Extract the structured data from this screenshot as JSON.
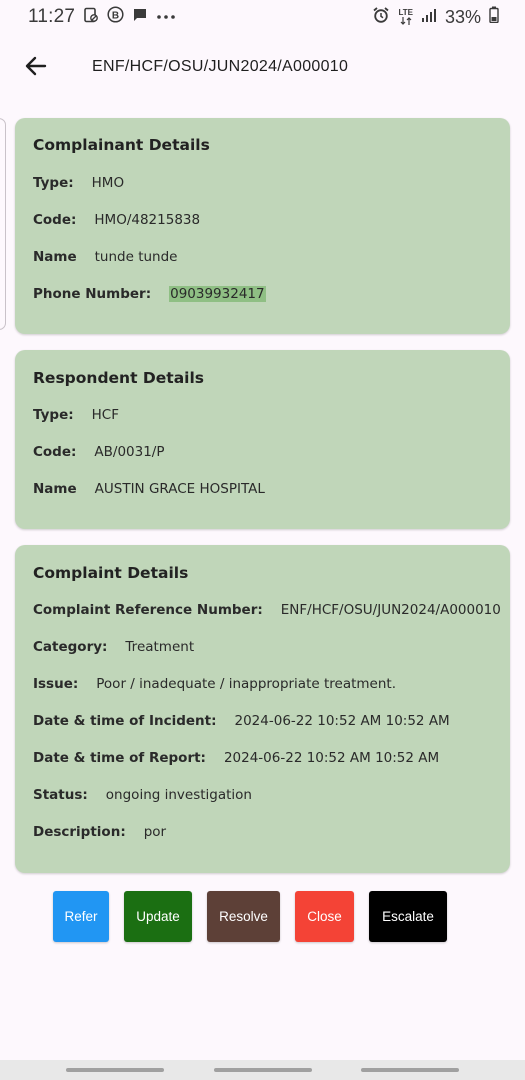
{
  "status_bar": {
    "time": "11:27",
    "left_icons": [
      "silent-phone-icon",
      "b-badge-icon",
      "message-icon",
      "more-dots-icon"
    ],
    "right_icons": [
      "alarm-icon",
      "lte-icon",
      "signal-icon"
    ],
    "network_label": "LTE",
    "battery": "33%"
  },
  "app_bar": {
    "title": "ENF/HCF/OSU/JUN2024/A000010",
    "back_icon": "arrow-left-icon"
  },
  "complainant": {
    "title": "Complainant Details",
    "type_label": "Type:",
    "type_value": "HMO",
    "code_label": "Code:",
    "code_value": "HMO/48215838",
    "name_label": "Name",
    "name_value": "tunde tunde",
    "phone_label": "Phone Number:",
    "phone_value": "09039932417"
  },
  "respondent": {
    "title": "Respondent Details",
    "type_label": "Type:",
    "type_value": "HCF",
    "code_label": "Code:",
    "code_value": "AB/0031/P",
    "name_label": "Name",
    "name_value": "AUSTIN GRACE HOSPITAL"
  },
  "complaint": {
    "title": "Complaint Details",
    "ref_label": "Complaint Reference Number:",
    "ref_value": "ENF/HCF/OSU/JUN2024/A000010",
    "category_label": "Category:",
    "category_value": "Treatment",
    "issue_label": "Issue:",
    "issue_value": "Poor / inadequate / inappropriate treatment.",
    "incident_label": "Date & time of Incident:",
    "incident_value": "2024-06-22 10:52 AM 10:52 AM",
    "report_label": "Date & time of Report:",
    "report_value": "2024-06-22 10:52 AM 10:52 AM",
    "status_label": "Status:",
    "status_value": "ongoing investigation",
    "description_label": "Description:",
    "description_value": "por"
  },
  "actions": {
    "refer": "Refer",
    "update": "Update",
    "resolve": "Resolve",
    "close": "Close",
    "escalate": "Escalate"
  },
  "colors": {
    "card_bg": "#c0d6b9",
    "highlight": "#8fbf84",
    "refer": "#2196f3",
    "update": "#1b6f12",
    "resolve": "#5d4037",
    "close": "#f44336",
    "escalate": "#000000"
  }
}
